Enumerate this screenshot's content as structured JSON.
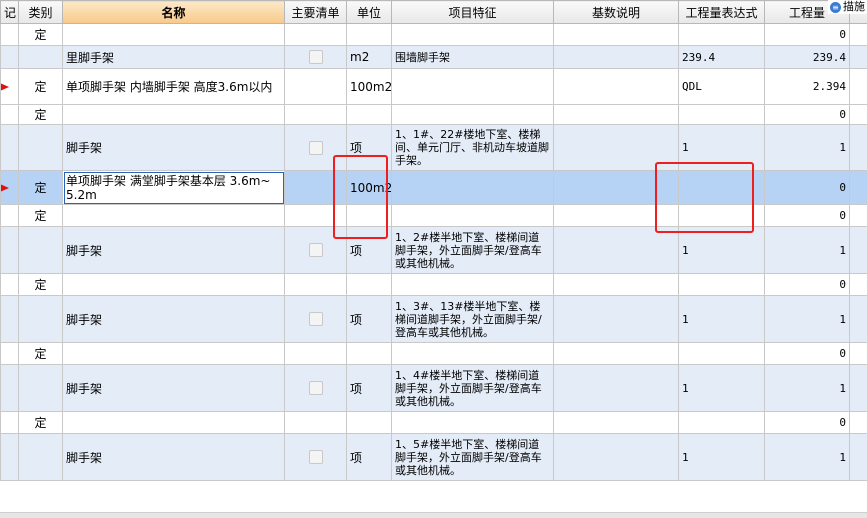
{
  "corner_button": {
    "label": "描施",
    "icon": "list-icon"
  },
  "headers": {
    "mark": "记",
    "type": "类别",
    "name": "名称",
    "main": "主要清单",
    "unit": "单位",
    "feature": "项目特征",
    "base": "基数说明",
    "expr": "工程量表达式",
    "qty": "工程量"
  },
  "rows": [
    {
      "kind": "def",
      "flag": false,
      "type": "定",
      "name": "",
      "checkbox": false,
      "unit": "",
      "feature": "",
      "base": "",
      "expr": "",
      "qty": "0"
    },
    {
      "kind": "item",
      "flag": false,
      "type": "",
      "name": "里脚手架",
      "checkbox": true,
      "unit": "m2",
      "feature": "围墙脚手架",
      "base": "",
      "expr": "239.4",
      "qty": "239.4"
    },
    {
      "kind": "def",
      "flag": true,
      "type": "定",
      "name": "单项脚手架 内墙脚手架 高度3.6m以内",
      "checkbox": false,
      "unit": "100m2",
      "feature": "",
      "base": "",
      "expr": "QDL",
      "qty": "2.394"
    },
    {
      "kind": "def",
      "flag": false,
      "type": "定",
      "name": "",
      "checkbox": false,
      "unit": "",
      "feature": "",
      "base": "",
      "expr": "",
      "qty": "0"
    },
    {
      "kind": "item",
      "flag": false,
      "type": "",
      "name": "脚手架",
      "checkbox": true,
      "unit": "项",
      "feature": "1、1#、22#楼地下室、楼梯间、单元门厅、非机动车坡道脚手架。",
      "base": "",
      "expr": "1",
      "qty": "1"
    },
    {
      "kind": "sel",
      "flag": true,
      "type": "定",
      "name": "单项脚手架 满堂脚手架基本层 3.6m~5.2m",
      "checkbox": false,
      "unit": "100m2",
      "feature": "",
      "base": "",
      "expr": "",
      "qty": "0"
    },
    {
      "kind": "def",
      "flag": false,
      "type": "定",
      "name": "",
      "checkbox": false,
      "unit": "",
      "feature": "",
      "base": "",
      "expr": "",
      "qty": "0"
    },
    {
      "kind": "item",
      "flag": false,
      "type": "",
      "name": "脚手架",
      "checkbox": true,
      "unit": "项",
      "feature": "1、2#楼半地下室、楼梯间道脚手架，外立面脚手架/登高车或其他机械。",
      "base": "",
      "expr": "1",
      "qty": "1"
    },
    {
      "kind": "def",
      "flag": false,
      "type": "定",
      "name": "",
      "checkbox": false,
      "unit": "",
      "feature": "",
      "base": "",
      "expr": "",
      "qty": "0"
    },
    {
      "kind": "item",
      "flag": false,
      "type": "",
      "name": "脚手架",
      "checkbox": true,
      "unit": "项",
      "feature": "1、3#、13#楼半地下室、楼梯间道脚手架，外立面脚手架/登高车或其他机械。",
      "base": "",
      "expr": "1",
      "qty": "1"
    },
    {
      "kind": "def",
      "flag": false,
      "type": "定",
      "name": "",
      "checkbox": false,
      "unit": "",
      "feature": "",
      "base": "",
      "expr": "",
      "qty": "0"
    },
    {
      "kind": "item",
      "flag": false,
      "type": "",
      "name": "脚手架",
      "checkbox": true,
      "unit": "项",
      "feature": "1、4#楼半地下室、楼梯间道脚手架，外立面脚手架/登高车或其他机械。",
      "base": "",
      "expr": "1",
      "qty": "1"
    },
    {
      "kind": "def",
      "flag": false,
      "type": "定",
      "name": "",
      "checkbox": false,
      "unit": "",
      "feature": "",
      "base": "",
      "expr": "",
      "qty": "0"
    },
    {
      "kind": "item",
      "flag": false,
      "type": "",
      "name": "脚手架",
      "checkbox": true,
      "unit": "项",
      "feature": "1、5#楼半地下室、楼梯间道脚手架，外立面脚手架/登高车或其他机械。",
      "base": "",
      "expr": "1",
      "qty": "1"
    }
  ]
}
